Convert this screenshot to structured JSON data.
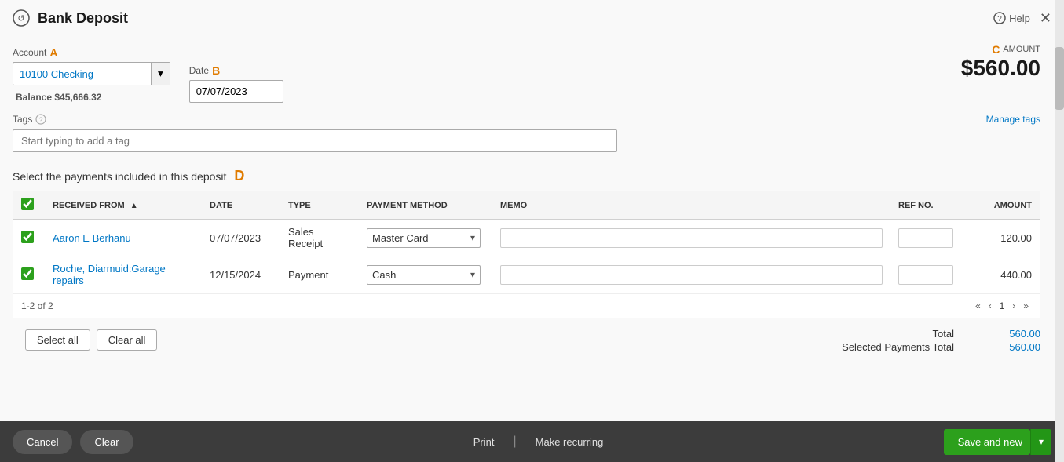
{
  "header": {
    "title": "Bank Deposit",
    "help_label": "Help",
    "icon": "💳"
  },
  "account": {
    "label": "Account",
    "letter": "A",
    "value": "10100 Checking",
    "balance_label": "Balance",
    "balance_value": "$45,666.32"
  },
  "date": {
    "label": "Date",
    "letter": "B",
    "value": "07/07/2023"
  },
  "amount": {
    "label": "AMOUNT",
    "letter": "C",
    "value": "$560.00"
  },
  "tags": {
    "label": "Tags",
    "manage_label": "Manage tags",
    "placeholder": "Start typing to add a tag"
  },
  "payments": {
    "title": "Select the payments included in this deposit",
    "letter": "D",
    "columns": {
      "received_from": "RECEIVED FROM",
      "date": "DATE",
      "type": "TYPE",
      "payment_method": "PAYMENT METHOD",
      "memo": "MEMO",
      "ref_no": "REF NO.",
      "amount": "AMOUNT"
    },
    "rows": [
      {
        "checked": true,
        "received_from": "Aaron E Berhanu",
        "date": "07/07/2023",
        "type": "Sales Receipt",
        "payment_method": "Master Card",
        "memo": "",
        "ref_no": "",
        "amount": "120.00"
      },
      {
        "checked": true,
        "received_from": "Roche, Diarmuid:Garage repairs",
        "date": "12/15/2024",
        "type": "Payment",
        "payment_method": "Cash",
        "memo": "",
        "ref_no": "",
        "amount": "440.00"
      }
    ],
    "pagination_info": "1-2 of 2",
    "page_current": "1",
    "select_all_label": "Select all",
    "clear_all_label": "Clear all",
    "total_label": "Total",
    "total_value": "560.00",
    "selected_payments_label": "Selected Payments Total",
    "selected_payments_value": "560.00"
  },
  "footer": {
    "cancel_label": "Cancel",
    "clear_label": "Clear",
    "print_label": "Print",
    "make_recurring_label": "Make recurring",
    "save_new_label": "Save and new"
  }
}
